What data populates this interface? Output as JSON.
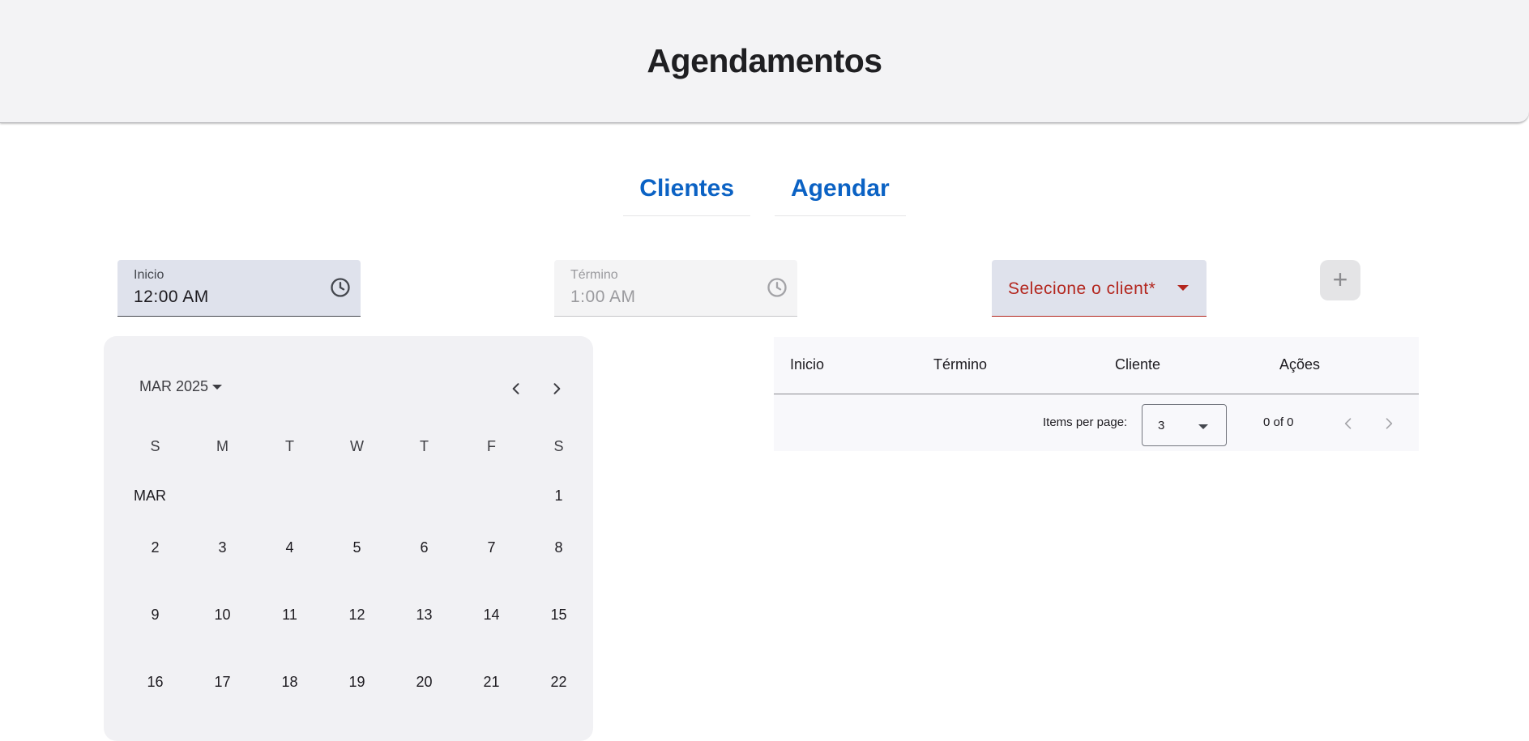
{
  "header": {
    "title": "Agendamentos"
  },
  "nav": {
    "tabs": [
      {
        "label": "Clientes"
      },
      {
        "label": "Agendar"
      }
    ]
  },
  "form": {
    "start": {
      "label": "Inicio",
      "value": "12:00 AM",
      "icon": "clock-icon"
    },
    "end": {
      "label": "Término",
      "value": "1:00 AM",
      "icon": "clock-icon",
      "disabled": true
    },
    "client_select": {
      "placeholder": "Selecione o client*",
      "required": true
    },
    "add_button": {
      "label": "+"
    }
  },
  "calendar": {
    "period_label": "MAR 2025",
    "weekdays": [
      "S",
      "M",
      "T",
      "W",
      "T",
      "F",
      "S"
    ],
    "month_label": "MAR",
    "weeks": [
      [
        "",
        "",
        "",
        "",
        "",
        "",
        "1"
      ],
      [
        "2",
        "3",
        "4",
        "5",
        "6",
        "7",
        "8"
      ],
      [
        "9",
        "10",
        "11",
        "12",
        "13",
        "14",
        "15"
      ],
      [
        "16",
        "17",
        "18",
        "19",
        "20",
        "21",
        "22"
      ]
    ]
  },
  "table": {
    "columns": [
      "Inicio",
      "Término",
      "Cliente",
      "Ações"
    ],
    "rows": [],
    "paginator": {
      "items_per_page_label": "Items per page:",
      "items_per_page": "3",
      "range": "0 of 0"
    }
  },
  "colors": {
    "accent": "#0b62c4",
    "error": "#b3261e",
    "surface": "#f3f3f5"
  }
}
